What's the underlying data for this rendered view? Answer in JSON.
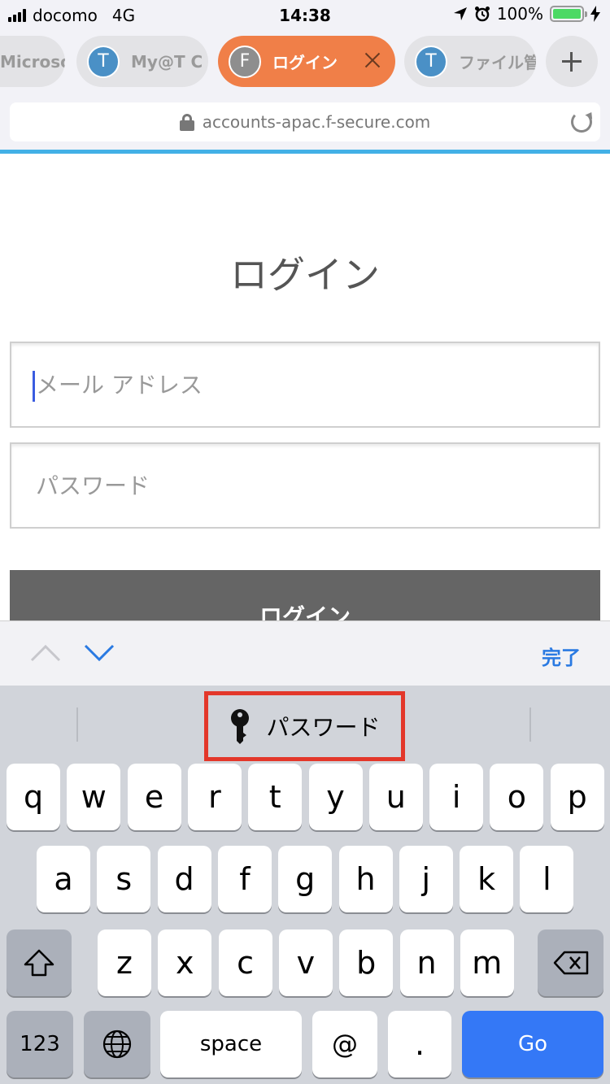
{
  "status": {
    "carrier": "docomo",
    "network": "4G",
    "time": "14:38",
    "battery": "100%"
  },
  "tabs": [
    {
      "avatar": "",
      "label": "Microsof",
      "active": false
    },
    {
      "avatar": "T",
      "label": "My@T C",
      "active": false
    },
    {
      "avatar": "F",
      "label": "ログイン",
      "active": true
    },
    {
      "avatar": "T",
      "label": "ファイル管",
      "active": false
    }
  ],
  "urlbar": {
    "url": "accounts-apac.f-secure.com"
  },
  "page": {
    "title": "ログイン",
    "email_placeholder": "メール アドレス",
    "password_placeholder": "パスワード",
    "login_button": "ログイン"
  },
  "accessory": {
    "done": "完了"
  },
  "keyboard": {
    "suggestion": "パスワード",
    "row1": [
      "q",
      "w",
      "e",
      "r",
      "t",
      "y",
      "u",
      "i",
      "o",
      "p"
    ],
    "row2": [
      "a",
      "s",
      "d",
      "f",
      "g",
      "h",
      "j",
      "k",
      "l"
    ],
    "row3": [
      "z",
      "x",
      "c",
      "v",
      "b",
      "n",
      "m"
    ],
    "numbers": "123",
    "space": "space",
    "at": "@",
    "dot": ".",
    "go": "Go"
  },
  "colors": {
    "active_tab": "#f07f48",
    "accent_blue": "#2a7ae2",
    "go_key": "#3478f6",
    "highlight": "#e3372a",
    "load_bar": "#42b0e6"
  }
}
